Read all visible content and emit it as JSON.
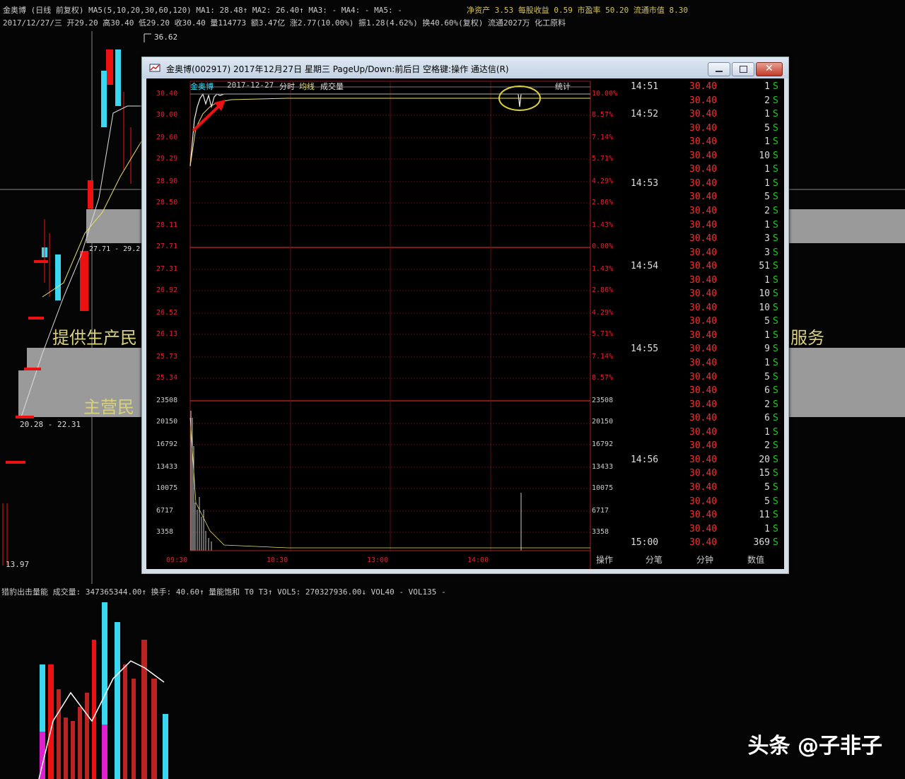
{
  "top_bar": {
    "line1": "金奥博 (日线 前复权) MA5(5,10,20,30,60,120) MA1: 28.48↑ MA2: 26.40↑ MA3: - MA4: - MA5: -",
    "line1_right": "净资产 3.53 每股收益 0.59 市盈率 50.20 流通市值 8.30",
    "line2": "2017/12/27/三 开29.20 高30.40 低29.20 收30.40 量114773 额3.47亿 涨2.77(10.00%) 振1.28(4.62%) 换40.60%(复权) 流通2027万 化工原料",
    "price_high": "36.62",
    "price_low": "13.97",
    "range_label": "20.28 - 22.31",
    "range_label2": "27.71 - 29.2"
  },
  "background_text": {
    "left_text1": "提供生产民",
    "right_text1": "服务",
    "left_text2": "主营民"
  },
  "volume_bar": {
    "label": "猎豹出击量能 成交量: 347365344.00↑ 换手: 40.60↑ 量能饱和 T0 T3↑ VOL5: 270327936.00↓ VOL40 - VOL135 -"
  },
  "window": {
    "title": "金奥博(002917) 2017年12月27日 星期三 PageUp/Down:前后日 空格键:操作 通达信(R)",
    "chart_header": {
      "name": "金奥博",
      "date": "2017-12-27",
      "tab1": "分时",
      "tab2": "均线",
      "tab3": "成交量",
      "stat": "统计"
    },
    "left_axis": [
      "30.40",
      "30.00",
      "29.60",
      "29.29",
      "28.90",
      "28.50",
      "28.11",
      "27.71",
      "27.31",
      "26.92",
      "26.52",
      "26.13",
      "25.73",
      "25.34",
      "23508",
      "20150",
      "16792",
      "13433",
      "10075",
      "6717",
      "3358"
    ],
    "right_axis": [
      "10.00%",
      "8.57%",
      "7.14%",
      "5.71%",
      "4.29%",
      "2.86%",
      "1.43%",
      "0.00%",
      "1.43%",
      "2.86%",
      "4.29%",
      "5.71%",
      "7.14%",
      "8.57%",
      "23508",
      "20150",
      "16792",
      "13433",
      "10075",
      "6717",
      "3358"
    ],
    "time_axis": [
      "09:30",
      "10:30",
      "13:00",
      "14:00"
    ],
    "bottom_tabs": [
      "操作",
      "分笔",
      "分钟",
      "数值"
    ],
    "ticks": [
      {
        "t": "14:51",
        "p": "30.40",
        "v": "1",
        "s": "S"
      },
      {
        "t": "",
        "p": "30.40",
        "v": "2",
        "s": "S"
      },
      {
        "t": "14:52",
        "p": "30.40",
        "v": "1",
        "s": "S"
      },
      {
        "t": "",
        "p": "30.40",
        "v": "5",
        "s": "S"
      },
      {
        "t": "",
        "p": "30.40",
        "v": "1",
        "s": "S"
      },
      {
        "t": "",
        "p": "30.40",
        "v": "10",
        "s": "S"
      },
      {
        "t": "",
        "p": "30.40",
        "v": "1",
        "s": "S"
      },
      {
        "t": "14:53",
        "p": "30.40",
        "v": "1",
        "s": "S"
      },
      {
        "t": "",
        "p": "30.40",
        "v": "5",
        "s": "S"
      },
      {
        "t": "",
        "p": "30.40",
        "v": "2",
        "s": "S"
      },
      {
        "t": "",
        "p": "30.40",
        "v": "1",
        "s": "S"
      },
      {
        "t": "",
        "p": "30.40",
        "v": "3",
        "s": "S"
      },
      {
        "t": "",
        "p": "30.40",
        "v": "3",
        "s": "S"
      },
      {
        "t": "14:54",
        "p": "30.40",
        "v": "51",
        "s": "S"
      },
      {
        "t": "",
        "p": "30.40",
        "v": "1",
        "s": "S"
      },
      {
        "t": "",
        "p": "30.40",
        "v": "10",
        "s": "S"
      },
      {
        "t": "",
        "p": "30.40",
        "v": "10",
        "s": "S"
      },
      {
        "t": "",
        "p": "30.40",
        "v": "5",
        "s": "S"
      },
      {
        "t": "",
        "p": "30.40",
        "v": "1",
        "s": "S"
      },
      {
        "t": "14:55",
        "p": "30.40",
        "v": "9",
        "s": "S"
      },
      {
        "t": "",
        "p": "30.40",
        "v": "1",
        "s": "S"
      },
      {
        "t": "",
        "p": "30.40",
        "v": "5",
        "s": "S"
      },
      {
        "t": "",
        "p": "30.40",
        "v": "6",
        "s": "S"
      },
      {
        "t": "",
        "p": "30.40",
        "v": "2",
        "s": "S"
      },
      {
        "t": "",
        "p": "30.40",
        "v": "6",
        "s": "S"
      },
      {
        "t": "",
        "p": "30.40",
        "v": "1",
        "s": "S"
      },
      {
        "t": "",
        "p": "30.40",
        "v": "2",
        "s": "S"
      },
      {
        "t": "14:56",
        "p": "30.40",
        "v": "20",
        "s": "S"
      },
      {
        "t": "",
        "p": "30.40",
        "v": "15",
        "s": "S"
      },
      {
        "t": "",
        "p": "30.40",
        "v": "5",
        "s": "S"
      },
      {
        "t": "",
        "p": "30.40",
        "v": "5",
        "s": "S"
      },
      {
        "t": "",
        "p": "30.40",
        "v": "11",
        "s": "S"
      },
      {
        "t": "",
        "p": "30.40",
        "v": "1",
        "s": "S"
      },
      {
        "t": "15:00",
        "p": "30.40",
        "v": "369",
        "s": "S"
      }
    ]
  },
  "watermark": "头条 @子非子",
  "colors": {
    "price_red": "#e33",
    "sell_green": "#2c2",
    "grid_red": "#6a1010",
    "cyan": "#3ad8f0",
    "magenta": "#e020d0"
  }
}
